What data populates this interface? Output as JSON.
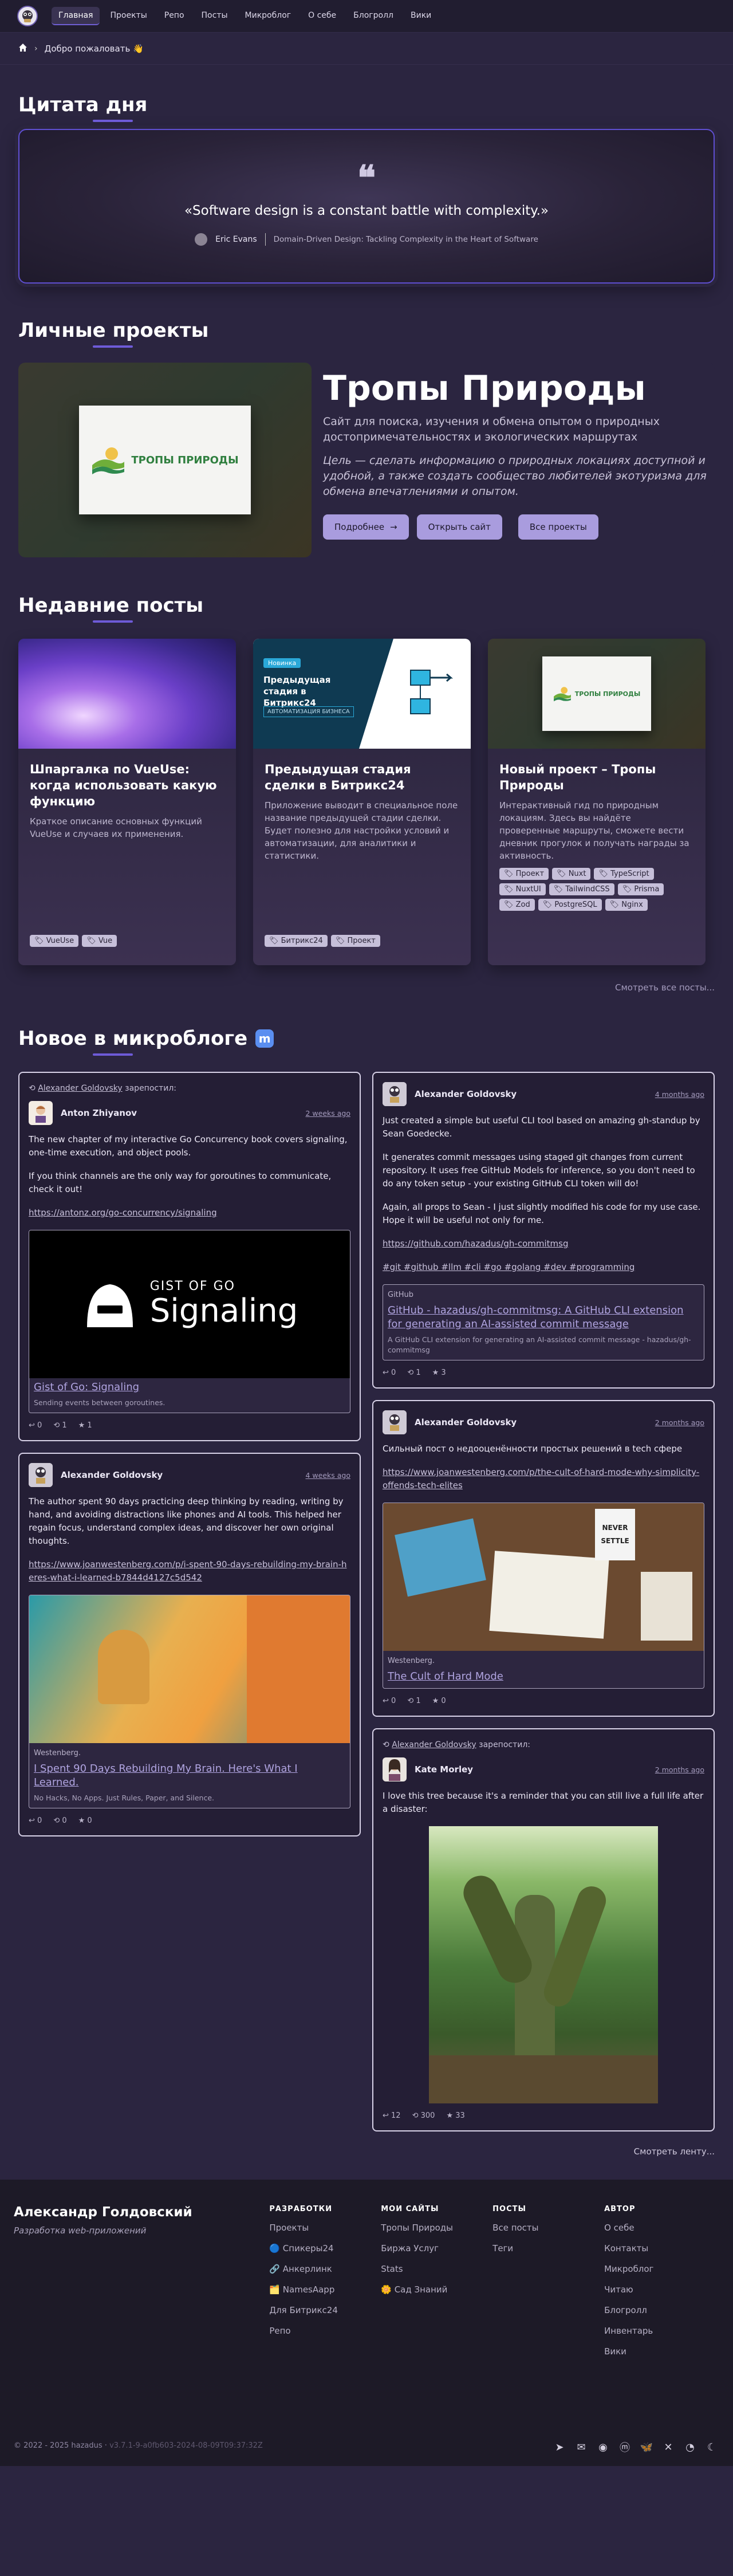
{
  "nav": {
    "items": [
      "Главная",
      "Проекты",
      "Репо",
      "Посты",
      "Микроблог",
      "О себе",
      "Блогролл",
      "Вики"
    ]
  },
  "breadcrumb": {
    "text": "Добро пожаловать 👋"
  },
  "quote": {
    "heading": "Цитата дня",
    "text": "«Software design is a constant battle with complexity.»",
    "author": "Eric Evans",
    "source": "Domain-Driven Design: Tackling Complexity in the Heart of Software"
  },
  "projects": {
    "heading": "Личные проекты",
    "logo_text": "ТРОПЫ ПРИРОДЫ",
    "title": "Тропы Природы",
    "desc": "Сайт для поиска, изучения и обмена опытом о природных достопримечательностях и экологических маршрутах",
    "goal": "Цель — сделать информацию о природных локациях доступной и удобной, а также создать сообщество любителей экотуризма для обмена впечатлениями и опытом.",
    "btn_more": "Подробнее",
    "btn_open": "Открыть сайт",
    "btn_all": "Все проекты"
  },
  "posts": {
    "heading": "Недавние посты",
    "items": [
      {
        "title": "Шпаргалка по VueUse: когда использовать какую функцию",
        "desc": "Краткое описание основных функций VueUse и случаев их применения.",
        "tags": [
          "VueUse",
          "Vue"
        ]
      },
      {
        "title": "Предыдущая стадия сделки в Битрикс24",
        "desc": "Приложение выводит в специальное поле название предыдущей стадии сделки. Будет полезно для настройки условий и автоматизации, для аналитики и статистики.",
        "tags": [
          "Битрикс24",
          "Проект"
        ],
        "img_badge": "Новинка",
        "img_title": "Предыдущая стадия в Битрикс24",
        "img_sub": "АВТОМАТИЗАЦИЯ БИЗНЕСА"
      },
      {
        "title": "Новый проект – Тропы Природы",
        "desc": "Интерактивный гид по природным локациям. Здесь вы найдёте проверенные маршруты, сможете вести дневник прогулок и получать награды за активность.",
        "tags": [
          "Проект",
          "Nuxt",
          "TypeScript",
          "NuxtUI",
          "TailwindCSS",
          "Prisma",
          "Zod",
          "PostgreSQL",
          "Nginx"
        ],
        "logo_text": "ТРОПЫ ПРИРОДЫ"
      }
    ],
    "see_all": "Смотреть все посты..."
  },
  "micro": {
    "heading": "Новое в микроблоге",
    "left": [
      {
        "reblog_user": "Alexander Goldovsky",
        "reblog_word": "зарепостил:",
        "name": "Anton Zhiyanov",
        "date": "2 weeks ago",
        "p1": "The new chapter of my interactive Go Concurrency book covers signaling, one-time execution, and object pools.",
        "p2": "If you think channels are the only way for goroutines to communicate, check it out!",
        "link": "https://antonz.org/go-concurrency/signaling",
        "card_top": "GIST OF GO",
        "card_big": "Signaling",
        "card_title": "Gist of Go: Signaling",
        "card_desc": "Sending events between goroutines.",
        "replies": "0",
        "boosts": "1",
        "favs": "1"
      },
      {
        "name": "Alexander Goldovsky",
        "date": "4 weeks ago",
        "p1": "The author spent 90 days practicing deep thinking by reading, writing by hand, and avoiding distractions like phones and AI tools. This helped her regain focus, understand complex ideas, and discover her own original thoughts.",
        "link": "https://www.joanwestenberg.com/p/i-spent-90-days-rebuilding-my-brain-heres-what-i-learned-b7844d4127c5d542",
        "card_site": "Westenberg.",
        "card_title": "I Spent 90 Days Rebuilding My Brain. Here's What I Learned.",
        "card_desc": "No Hacks, No Apps. Just Rules, Paper, and Silence.",
        "replies": "0",
        "boosts": "0",
        "favs": "0"
      }
    ],
    "right": [
      {
        "name": "Alexander Goldovsky",
        "date": "4 months ago",
        "p1": "Just created a simple but useful CLI tool based on amazing gh-standup by Sean Goedecke.",
        "p2": "It generates commit messages using staged git changes from current repository. It uses free GitHub Models for inference, so you don't need to do any token setup - your existing GitHub CLI token will do!",
        "p3": "Again, all props to Sean - I just slightly modified his code for my use case. Hope it will be useful not only for me.",
        "link": "https://github.com/hazadus/gh-commitmsg",
        "hashtags": "#git #github #llm #cli #go #golang #dev #programming",
        "card_site": "GitHub",
        "card_title": "GitHub - hazadus/gh-commitmsg: A GitHub CLI extension for generating an AI-assisted commit message",
        "card_desc": "A GitHub CLI extension for generating an AI-assisted commit message - hazadus/gh-commitmsg",
        "replies": "0",
        "boosts": "1",
        "favs": "3"
      },
      {
        "name": "Alexander Goldovsky",
        "date": "2 months ago",
        "p1": "Сильный пост о недооценённости простых решений в tech сфере",
        "link": "https://www.joanwestenberg.com/p/the-cult-of-hard-mode-why-simplicity-offends-tech-elites",
        "card_site": "Westenberg.",
        "card_title": "The Cult of Hard Mode",
        "img_text": "NEVER SETTLE",
        "replies": "0",
        "boosts": "1",
        "favs": "0"
      },
      {
        "reblog_user": "Alexander Goldovsky",
        "reblog_word": "зарепостил:",
        "name": "Kate Morley",
        "date": "2 months ago",
        "p1": "I love this tree because it's a reminder that you can still live a full life after a disaster:",
        "replies": "12",
        "boosts": "300",
        "favs": "33"
      }
    ],
    "see_feed": "Смотреть ленту..."
  },
  "footer": {
    "name": "Александр Голдовский",
    "sub": "Разработка web-приложений",
    "cols": [
      {
        "head": "РАЗРАБОТКИ",
        "links": [
          "Проекты",
          "🔵 Спикеры24",
          "🔗 Анкерлинк",
          "🗂️ NamesAapp",
          "Для Битрикс24",
          "Репо"
        ]
      },
      {
        "head": "МОИ САЙТЫ",
        "links": [
          "Тропы Природы",
          "Биржа Услуг",
          "Stats",
          "🌼 Сад Знаний"
        ]
      },
      {
        "head": "ПОСТЫ",
        "links": [
          "Все посты",
          "Теги"
        ]
      },
      {
        "head": "АВТОР",
        "links": [
          "О себе",
          "Контакты",
          "Микроблог",
          "Читаю",
          "Блогролл",
          "Инвентарь",
          "Вики"
        ]
      }
    ],
    "copyright": "© 2022 - 2025 hazadus",
    "version": "v3.7.1-9-a0fb603-2024-08-09T09:37:32Z"
  },
  "colors": {
    "accent": "#6e5bd8",
    "bg": "#2b2540",
    "card": "#3a3150",
    "footer": "#1d1a27"
  }
}
